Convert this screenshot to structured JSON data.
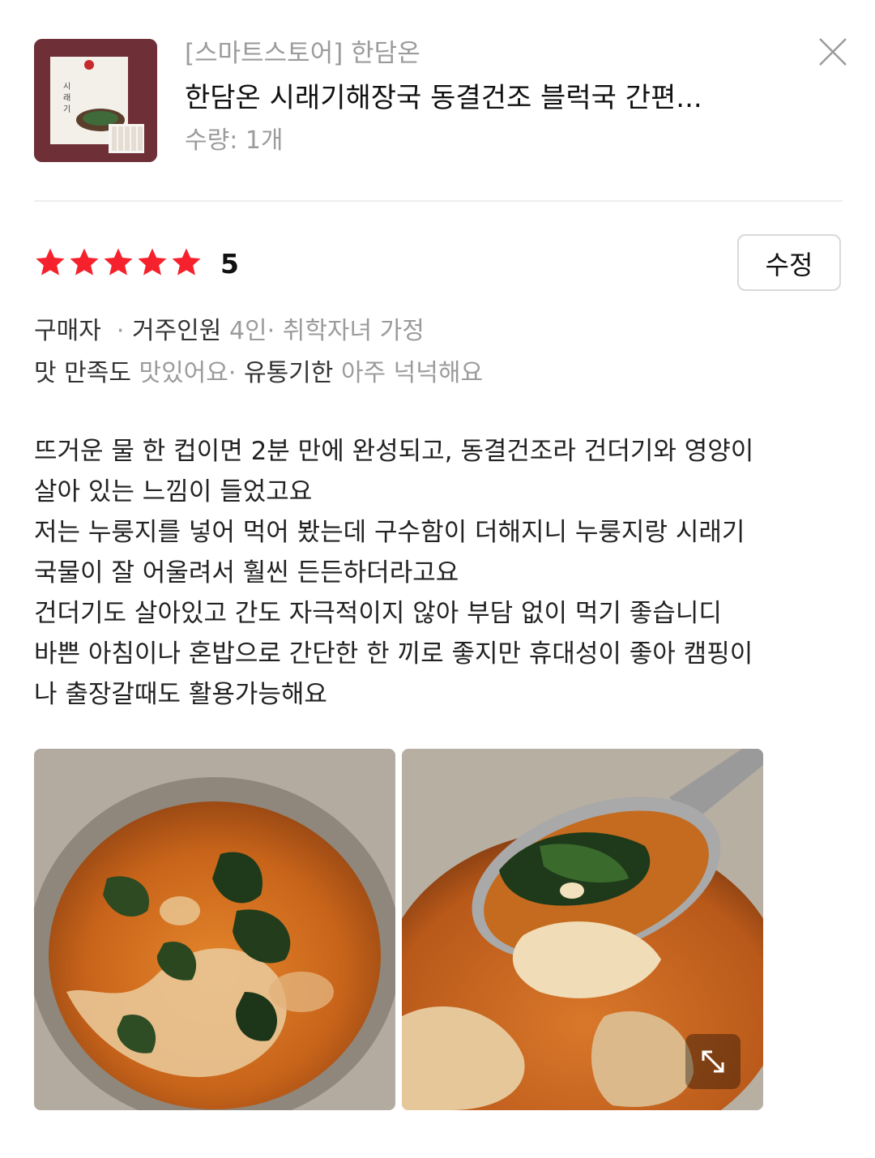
{
  "product": {
    "store": "[스마트스토어] 한담온",
    "title": "한담온 시래기해장국 동결건조 블럭국 간편...",
    "quantity": "수량: 1개"
  },
  "review": {
    "rating": "5",
    "edit_label": "수정",
    "meta1": {
      "buyer": "구매자",
      "household_key": "거주인원",
      "household_value": "4인",
      "kids_value": "취학자녀 가정"
    },
    "meta2": {
      "taste_key": "맛 만족도",
      "taste_value": "맛있어요",
      "expiry_key": "유통기한",
      "expiry_value": "아주 넉넉해요"
    },
    "lines": [
      "뜨거운 물 한 컵이면 2분 만에 완성되고, 동결건조라 건더기와 영양이",
      "살아 있는 느낌이 들었고요",
      "저는 누룽지를 넣어 먹어 봤는데 구수함이 더해지니 누룽지랑 시래기",
      "국물이 잘 어울려서 훨씬 든든하더라고요",
      "건더기도 살아있고 간도 자극적이지 않아 부담 없이 먹기 좋습니디",
      "바쁜 아침이나 혼밥으로 간단한 한 끼로 좋지만 휴대성이 좋아 캠핑이",
      "나 출장갈때도 활용가능해요"
    ]
  },
  "colors": {
    "star": "#f5222d",
    "muted_text": "#9b9b9b",
    "thumbnail_bg": "#6a2f35"
  },
  "icons": [
    "close-icon",
    "star-icon",
    "expand-icon"
  ]
}
